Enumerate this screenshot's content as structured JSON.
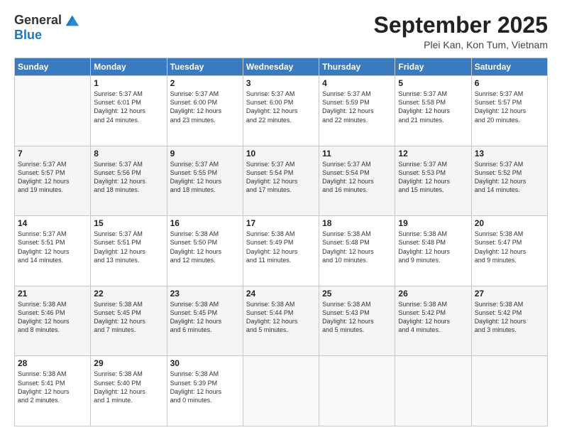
{
  "header": {
    "logo_line1": "General",
    "logo_line2": "Blue",
    "month_title": "September 2025",
    "location": "Plei Kan, Kon Tum, Vietnam"
  },
  "weekdays": [
    "Sunday",
    "Monday",
    "Tuesday",
    "Wednesday",
    "Thursday",
    "Friday",
    "Saturday"
  ],
  "weeks": [
    [
      {
        "day": "",
        "info": ""
      },
      {
        "day": "1",
        "info": "Sunrise: 5:37 AM\nSunset: 6:01 PM\nDaylight: 12 hours\nand 24 minutes."
      },
      {
        "day": "2",
        "info": "Sunrise: 5:37 AM\nSunset: 6:00 PM\nDaylight: 12 hours\nand 23 minutes."
      },
      {
        "day": "3",
        "info": "Sunrise: 5:37 AM\nSunset: 6:00 PM\nDaylight: 12 hours\nand 22 minutes."
      },
      {
        "day": "4",
        "info": "Sunrise: 5:37 AM\nSunset: 5:59 PM\nDaylight: 12 hours\nand 22 minutes."
      },
      {
        "day": "5",
        "info": "Sunrise: 5:37 AM\nSunset: 5:58 PM\nDaylight: 12 hours\nand 21 minutes."
      },
      {
        "day": "6",
        "info": "Sunrise: 5:37 AM\nSunset: 5:57 PM\nDaylight: 12 hours\nand 20 minutes."
      }
    ],
    [
      {
        "day": "7",
        "info": "Sunrise: 5:37 AM\nSunset: 5:57 PM\nDaylight: 12 hours\nand 19 minutes."
      },
      {
        "day": "8",
        "info": "Sunrise: 5:37 AM\nSunset: 5:56 PM\nDaylight: 12 hours\nand 18 minutes."
      },
      {
        "day": "9",
        "info": "Sunrise: 5:37 AM\nSunset: 5:55 PM\nDaylight: 12 hours\nand 18 minutes."
      },
      {
        "day": "10",
        "info": "Sunrise: 5:37 AM\nSunset: 5:54 PM\nDaylight: 12 hours\nand 17 minutes."
      },
      {
        "day": "11",
        "info": "Sunrise: 5:37 AM\nSunset: 5:54 PM\nDaylight: 12 hours\nand 16 minutes."
      },
      {
        "day": "12",
        "info": "Sunrise: 5:37 AM\nSunset: 5:53 PM\nDaylight: 12 hours\nand 15 minutes."
      },
      {
        "day": "13",
        "info": "Sunrise: 5:37 AM\nSunset: 5:52 PM\nDaylight: 12 hours\nand 14 minutes."
      }
    ],
    [
      {
        "day": "14",
        "info": "Sunrise: 5:37 AM\nSunset: 5:51 PM\nDaylight: 12 hours\nand 14 minutes."
      },
      {
        "day": "15",
        "info": "Sunrise: 5:37 AM\nSunset: 5:51 PM\nDaylight: 12 hours\nand 13 minutes."
      },
      {
        "day": "16",
        "info": "Sunrise: 5:38 AM\nSunset: 5:50 PM\nDaylight: 12 hours\nand 12 minutes."
      },
      {
        "day": "17",
        "info": "Sunrise: 5:38 AM\nSunset: 5:49 PM\nDaylight: 12 hours\nand 11 minutes."
      },
      {
        "day": "18",
        "info": "Sunrise: 5:38 AM\nSunset: 5:48 PM\nDaylight: 12 hours\nand 10 minutes."
      },
      {
        "day": "19",
        "info": "Sunrise: 5:38 AM\nSunset: 5:48 PM\nDaylight: 12 hours\nand 9 minutes."
      },
      {
        "day": "20",
        "info": "Sunrise: 5:38 AM\nSunset: 5:47 PM\nDaylight: 12 hours\nand 9 minutes."
      }
    ],
    [
      {
        "day": "21",
        "info": "Sunrise: 5:38 AM\nSunset: 5:46 PM\nDaylight: 12 hours\nand 8 minutes."
      },
      {
        "day": "22",
        "info": "Sunrise: 5:38 AM\nSunset: 5:45 PM\nDaylight: 12 hours\nand 7 minutes."
      },
      {
        "day": "23",
        "info": "Sunrise: 5:38 AM\nSunset: 5:45 PM\nDaylight: 12 hours\nand 6 minutes."
      },
      {
        "day": "24",
        "info": "Sunrise: 5:38 AM\nSunset: 5:44 PM\nDaylight: 12 hours\nand 5 minutes."
      },
      {
        "day": "25",
        "info": "Sunrise: 5:38 AM\nSunset: 5:43 PM\nDaylight: 12 hours\nand 5 minutes."
      },
      {
        "day": "26",
        "info": "Sunrise: 5:38 AM\nSunset: 5:42 PM\nDaylight: 12 hours\nand 4 minutes."
      },
      {
        "day": "27",
        "info": "Sunrise: 5:38 AM\nSunset: 5:42 PM\nDaylight: 12 hours\nand 3 minutes."
      }
    ],
    [
      {
        "day": "28",
        "info": "Sunrise: 5:38 AM\nSunset: 5:41 PM\nDaylight: 12 hours\nand 2 minutes."
      },
      {
        "day": "29",
        "info": "Sunrise: 5:38 AM\nSunset: 5:40 PM\nDaylight: 12 hours\nand 1 minute."
      },
      {
        "day": "30",
        "info": "Sunrise: 5:38 AM\nSunset: 5:39 PM\nDaylight: 12 hours\nand 0 minutes."
      },
      {
        "day": "",
        "info": ""
      },
      {
        "day": "",
        "info": ""
      },
      {
        "day": "",
        "info": ""
      },
      {
        "day": "",
        "info": ""
      }
    ]
  ]
}
